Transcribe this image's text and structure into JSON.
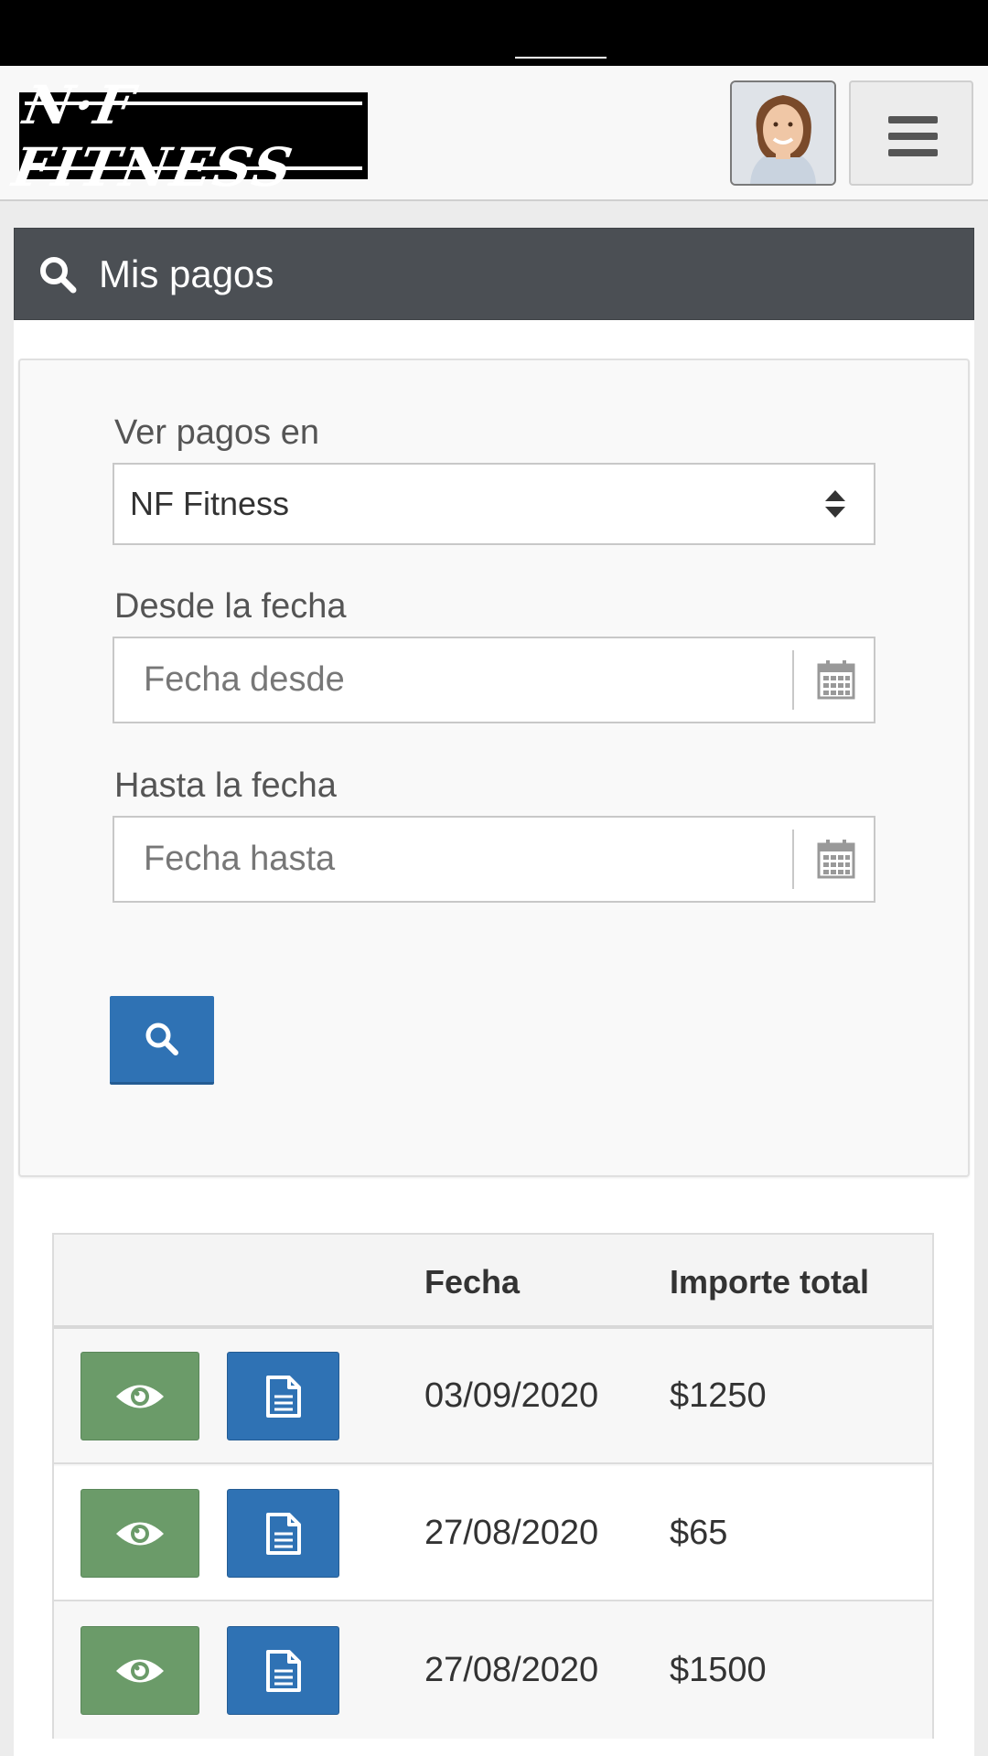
{
  "brand": {
    "logo_text": "N·F FITNESS"
  },
  "header": {
    "title": "Mis pagos"
  },
  "filters": {
    "gym_label": "Ver pagos en",
    "gym_value": "NF Fitness",
    "from_label": "Desde la fecha",
    "from_placeholder": "Fecha desde",
    "to_label": "Hasta la fecha",
    "to_placeholder": "Fecha hasta"
  },
  "table": {
    "headers": {
      "actions": "",
      "date": "Fecha",
      "total": "Importe total"
    },
    "rows": [
      {
        "date": "03/09/2020",
        "total": "$1250"
      },
      {
        "date": "27/08/2020",
        "total": "$65"
      },
      {
        "date": "27/08/2020",
        "total": "$1500"
      }
    ]
  },
  "icons": {
    "search": "search-icon",
    "menu": "hamburger-icon",
    "calendar": "calendar-icon",
    "view": "eye-icon",
    "document": "document-icon",
    "select": "sort-arrows-icon"
  },
  "colors": {
    "header_bg": "#4b4f54",
    "primary": "#2f72b4",
    "success": "#6b9b69"
  }
}
